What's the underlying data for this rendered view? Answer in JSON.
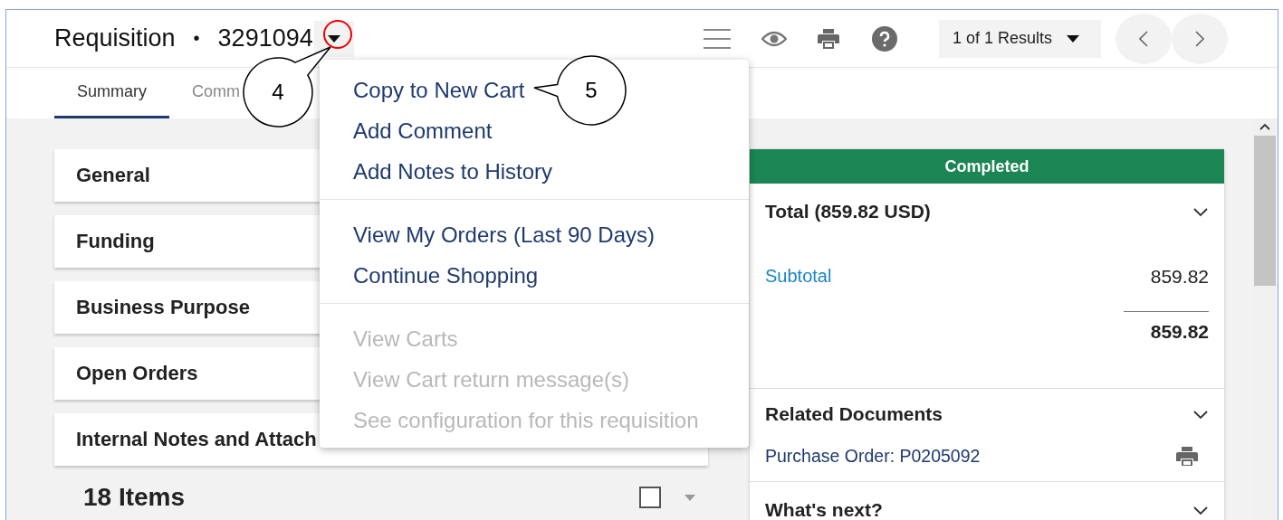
{
  "header": {
    "title": "Requisition",
    "separator": "•",
    "number": "3291094",
    "results": "1 of 1 Results"
  },
  "tabs": [
    {
      "label": "Summary",
      "selected": true
    },
    {
      "label": "Comm",
      "selected": false
    }
  ],
  "sections": [
    {
      "label": "General"
    },
    {
      "label": "Funding"
    },
    {
      "label": "Business Purpose"
    },
    {
      "label": "Open Orders"
    },
    {
      "label": "Internal Notes and Attach"
    }
  ],
  "items": {
    "count": "18 Items",
    "checked": false
  },
  "menu": {
    "groups": [
      [
        {
          "label": "Copy to New Cart",
          "disabled": false
        },
        {
          "label": "Add Comment",
          "disabled": false
        },
        {
          "label": "Add Notes to History",
          "disabled": false
        }
      ],
      [
        {
          "label": "View My Orders (Last 90 Days)",
          "disabled": false
        },
        {
          "label": "Continue Shopping",
          "disabled": false
        }
      ],
      [
        {
          "label": "View Carts",
          "disabled": true
        },
        {
          "label": "View Cart return message(s)",
          "disabled": true
        },
        {
          "label": "See configuration for this requisition",
          "disabled": true
        }
      ]
    ]
  },
  "status": {
    "label": "Completed"
  },
  "total": {
    "title": "Total (859.82 USD)",
    "rows": [
      {
        "label": "Subtotal",
        "value": "859.82"
      }
    ],
    "sum": "859.82"
  },
  "related": {
    "title": "Related Documents",
    "links": [
      {
        "label": "Purchase Order: P0205092"
      }
    ]
  },
  "next": {
    "title": "What's next?"
  },
  "callouts": [
    {
      "number": "4"
    },
    {
      "number": "5"
    }
  ]
}
